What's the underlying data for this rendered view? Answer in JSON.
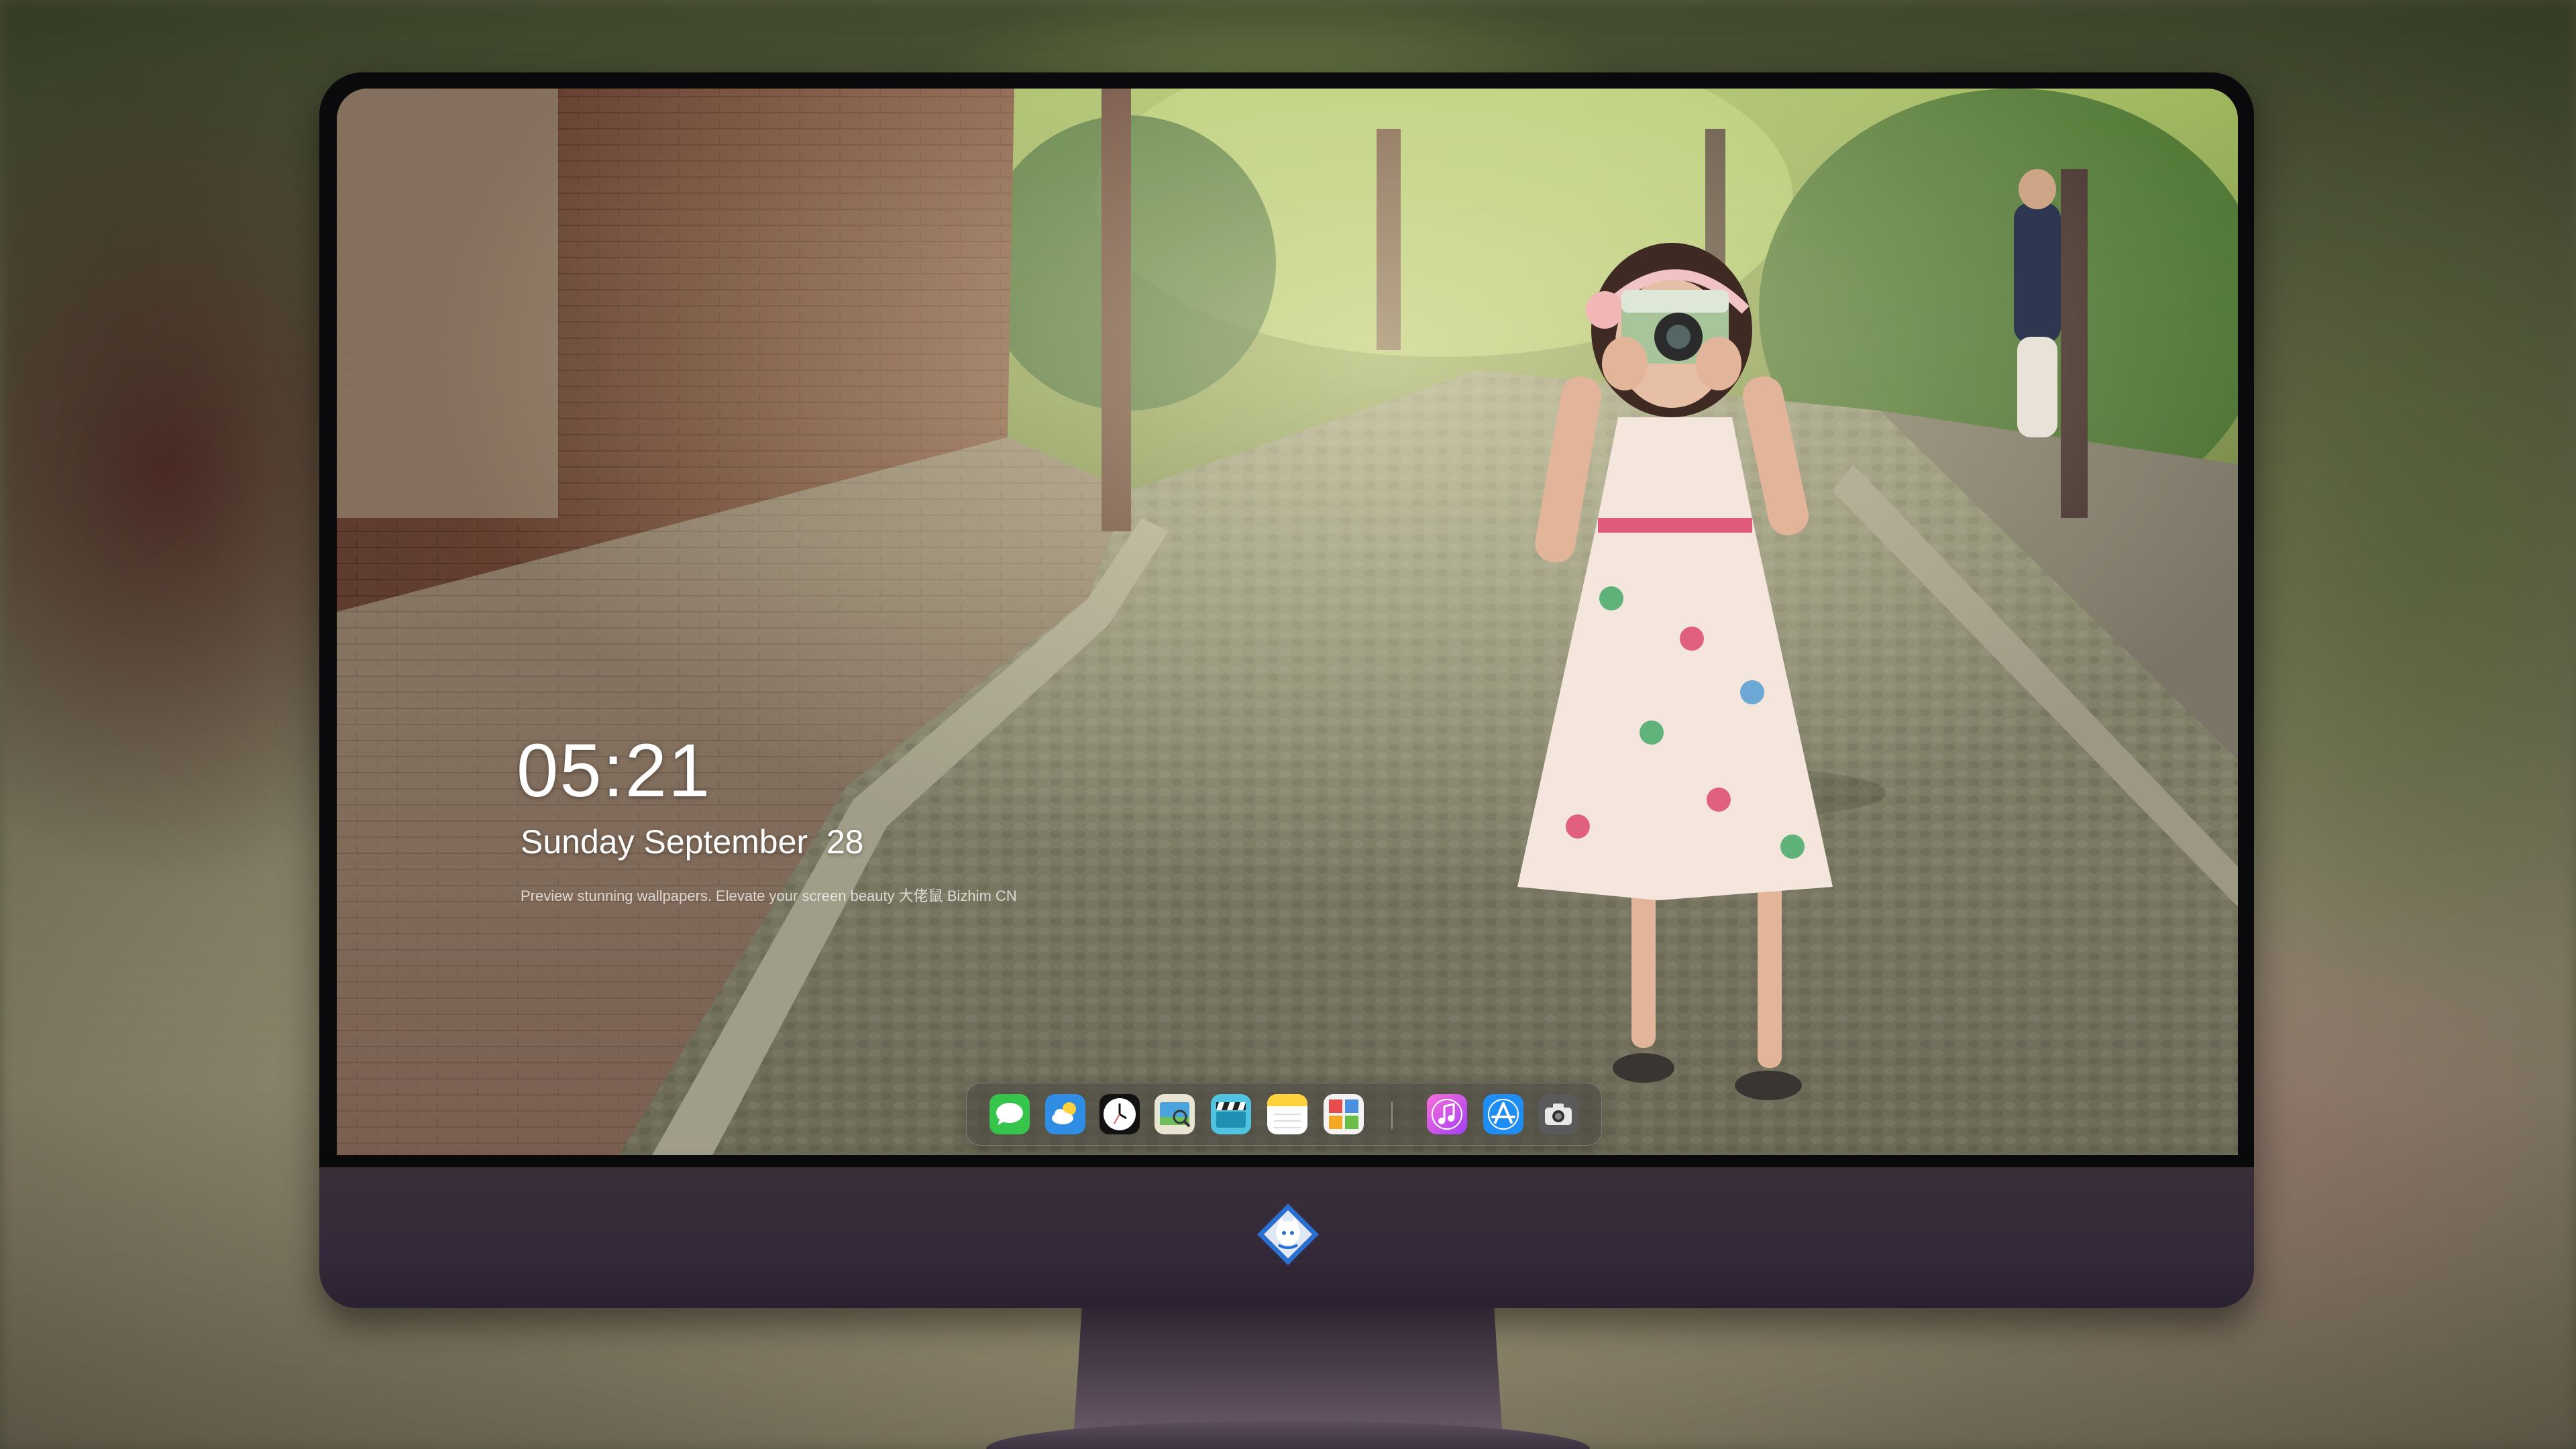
{
  "lock_screen": {
    "time": "05:21",
    "date": "Sunday September  28",
    "caption": "Preview stunning wallpapers. Elevate your screen beauty 大佬鼠 Bizhim CN"
  },
  "dock": {
    "apps": [
      {
        "name": "Messages",
        "icon": "messages-icon"
      },
      {
        "name": "Weather",
        "icon": "weather-icon"
      },
      {
        "name": "Clock",
        "icon": "clock-icon"
      },
      {
        "name": "Preview",
        "icon": "preview-icon"
      },
      {
        "name": "Clips",
        "icon": "clapperboard-icon"
      },
      {
        "name": "Notes",
        "icon": "notes-icon"
      },
      {
        "name": "Photo Booth",
        "icon": "photo-booth-icon"
      },
      {
        "name": "iTunes",
        "icon": "music-note-icon"
      },
      {
        "name": "App Store",
        "icon": "app-store-icon"
      },
      {
        "name": "Screenshot",
        "icon": "camera-icon"
      }
    ]
  },
  "colors": {
    "chin": "#34293a",
    "bezel": "#0a0a0c",
    "dock_background": "rgba(70,66,62,0.55)",
    "clock_text": "#ffffff"
  }
}
